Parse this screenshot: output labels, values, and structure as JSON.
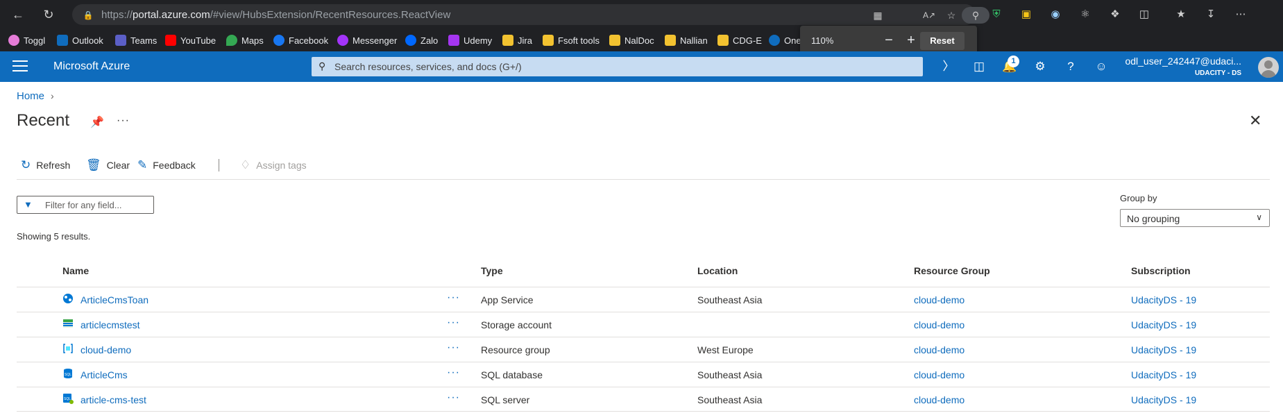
{
  "browser": {
    "url_prefix": "https://",
    "url_host": "portal.azure.com",
    "url_path": "/#view/HubsExtension/RecentResources.ReactView",
    "bookmarks": [
      {
        "label": "Toggl",
        "color": "#e57cd8"
      },
      {
        "label": "Outlook",
        "color": "#0f6cbd"
      },
      {
        "label": "Teams",
        "color": "#5b5fc7"
      },
      {
        "label": "YouTube",
        "color": "#ff0000"
      },
      {
        "label": "Maps",
        "color": "#34a853"
      },
      {
        "label": "Facebook",
        "color": "#1877f2"
      },
      {
        "label": "Messenger",
        "color": "#a334fa"
      },
      {
        "label": "Zalo",
        "color": "#0068ff"
      },
      {
        "label": "Udemy",
        "color": "#a435f0"
      },
      {
        "label": "Jira",
        "color": "#f2c230"
      },
      {
        "label": "Fsoft tools",
        "color": "#f2c230"
      },
      {
        "label": "NalDoc",
        "color": "#f2c230"
      },
      {
        "label": "Nallian",
        "color": "#f2c230"
      },
      {
        "label": "CDG-E",
        "color": "#f2c230"
      },
      {
        "label": "One",
        "color": "#0f6cbd"
      }
    ],
    "zoom": {
      "level": "110%",
      "reset_label": "Reset"
    }
  },
  "azure": {
    "brand": "Microsoft Azure",
    "search_placeholder": "Search resources, services, and docs (G+/)",
    "notification_count": "1",
    "user_name": "odl_user_242447@udaci...",
    "user_org": "UDACITY - DS"
  },
  "page": {
    "breadcrumb_home": "Home",
    "title": "Recent",
    "commands": {
      "refresh": "Refresh",
      "clear": "Clear",
      "feedback": "Feedback",
      "assign_tags": "Assign tags"
    },
    "filter_placeholder": "Filter for any field...",
    "group_by_label": "Group by",
    "group_by_value": "No grouping",
    "result_count": "Showing 5 results."
  },
  "table": {
    "headers": {
      "name": "Name",
      "type": "Type",
      "location": "Location",
      "resource_group": "Resource Group",
      "subscription": "Subscription"
    },
    "rows": [
      {
        "name": "ArticleCmsToan",
        "type": "App Service",
        "location": "Southeast Asia",
        "resource_group": "cloud-demo",
        "subscription": "UdacityDS - 19",
        "icon": "app-service-icon"
      },
      {
        "name": "articlecmstest",
        "type": "Storage account",
        "location": "",
        "resource_group": "cloud-demo",
        "subscription": "UdacityDS - 19",
        "icon": "storage-account-icon"
      },
      {
        "name": "cloud-demo",
        "type": "Resource group",
        "location": "West Europe",
        "resource_group": "cloud-demo",
        "subscription": "UdacityDS - 19",
        "icon": "resource-group-icon"
      },
      {
        "name": "ArticleCms",
        "type": "SQL database",
        "location": "Southeast Asia",
        "resource_group": "cloud-demo",
        "subscription": "UdacityDS - 19",
        "icon": "sql-database-icon"
      },
      {
        "name": "article-cms-test",
        "type": "SQL server",
        "location": "Southeast Asia",
        "resource_group": "cloud-demo",
        "subscription": "UdacityDS - 19",
        "icon": "sql-server-icon"
      }
    ]
  }
}
